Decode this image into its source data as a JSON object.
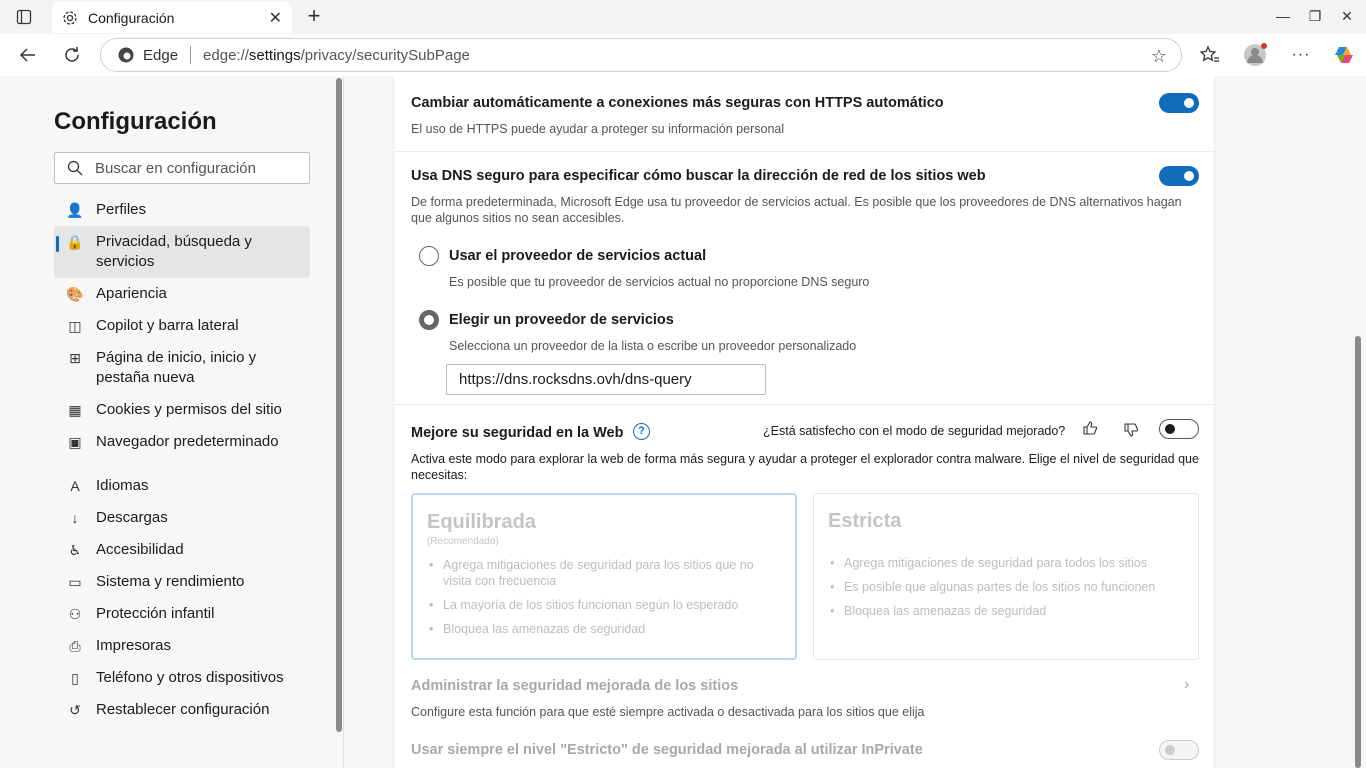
{
  "browser": {
    "tab_title": "Configuración",
    "edge_label": "Edge",
    "url_prefix": "edge://",
    "url_host": "settings",
    "url_path": "/privacy/securitySubPage"
  },
  "sidebar": {
    "title": "Configuración",
    "search_placeholder": "Buscar en configuración",
    "items": [
      {
        "label": "Perfiles",
        "icon": "profile-icon"
      },
      {
        "label": "Privacidad, búsqueda y servicios",
        "icon": "lock-icon",
        "active": true
      },
      {
        "label": "Apariencia",
        "icon": "palette-icon"
      },
      {
        "label": "Copilot y barra lateral",
        "icon": "sidebar-icon"
      },
      {
        "label": "Página de inicio, inicio y pestaña nueva",
        "icon": "home-icon"
      },
      {
        "label": "Cookies y permisos del sitio",
        "icon": "cookie-icon"
      },
      {
        "label": "Navegador predeterminado",
        "icon": "browser-icon"
      },
      {
        "label": "Idiomas",
        "icon": "language-icon"
      },
      {
        "label": "Descargas",
        "icon": "download-icon"
      },
      {
        "label": "Accesibilidad",
        "icon": "accessibility-icon"
      },
      {
        "label": "Sistema y rendimiento",
        "icon": "laptop-icon"
      },
      {
        "label": "Protección infantil",
        "icon": "family-icon"
      },
      {
        "label": "Impresoras",
        "icon": "printer-icon"
      },
      {
        "label": "Teléfono y otros dispositivos",
        "icon": "phone-icon"
      },
      {
        "label": "Restablecer configuración",
        "icon": "reset-icon"
      }
    ]
  },
  "settings": {
    "https": {
      "title": "Cambiar automáticamente a conexiones más seguras con HTTPS automático",
      "desc": "El uso de HTTPS puede ayudar a proteger su información personal",
      "enabled": true
    },
    "dns": {
      "title": "Usa DNS seguro para especificar cómo buscar la dirección de red de los sitios web",
      "desc": "De forma predeterminada, Microsoft Edge usa tu proveedor de servicios actual. Es posible que los proveedores de DNS alternativos hagan que algunos sitios no sean accesibles.",
      "enabled": true,
      "option_current": "Usar el proveedor de servicios actual",
      "option_current_desc": "Es posible que tu proveedor de servicios actual no proporcione DNS seguro",
      "option_choose": "Elegir un proveedor de servicios",
      "option_choose_desc": "Selecciona un proveedor de la lista o escribe un proveedor personalizado",
      "provider_value": "https://dns.rocksdns.ovh/dns-query"
    },
    "enhanced": {
      "title": "Mejore su seguridad en la Web",
      "feedback": "¿Está satisfecho con el modo de seguridad mejorado?",
      "desc": "Activa este modo para explorar la web de forma más segura y ayudar a proteger el explorador contra malware. Elige el nivel de seguridad que necesitas:",
      "enabled": false,
      "balanced": {
        "title": "Equilibrada",
        "subtitle": "(Recomendado)",
        "bullets": [
          "Agrega mitigaciones de seguridad para los sitios que no visita con frecuencia",
          "La mayoría de los sitios funcionan según lo esperado",
          "Bloquea las amenazas de seguridad"
        ]
      },
      "strict": {
        "title": "Estricta",
        "bullets": [
          "Agrega mitigaciones de seguridad para todos los sitios",
          "Es posible que algunas partes de los sitios no funcionen",
          "Bloquea las amenazas de seguridad"
        ]
      }
    },
    "manage_sites": {
      "title": "Administrar la seguridad mejorada de los sitios",
      "desc": "Configure esta función para que esté siempre activada o desactivada para los sitios que elija"
    },
    "inprivate": {
      "title": "Usar siempre el nivel \"Estricto\" de seguridad mejorada al utilizar InPrivate",
      "enabled": false
    }
  },
  "colors": {
    "accent": "#0f6cbd"
  }
}
